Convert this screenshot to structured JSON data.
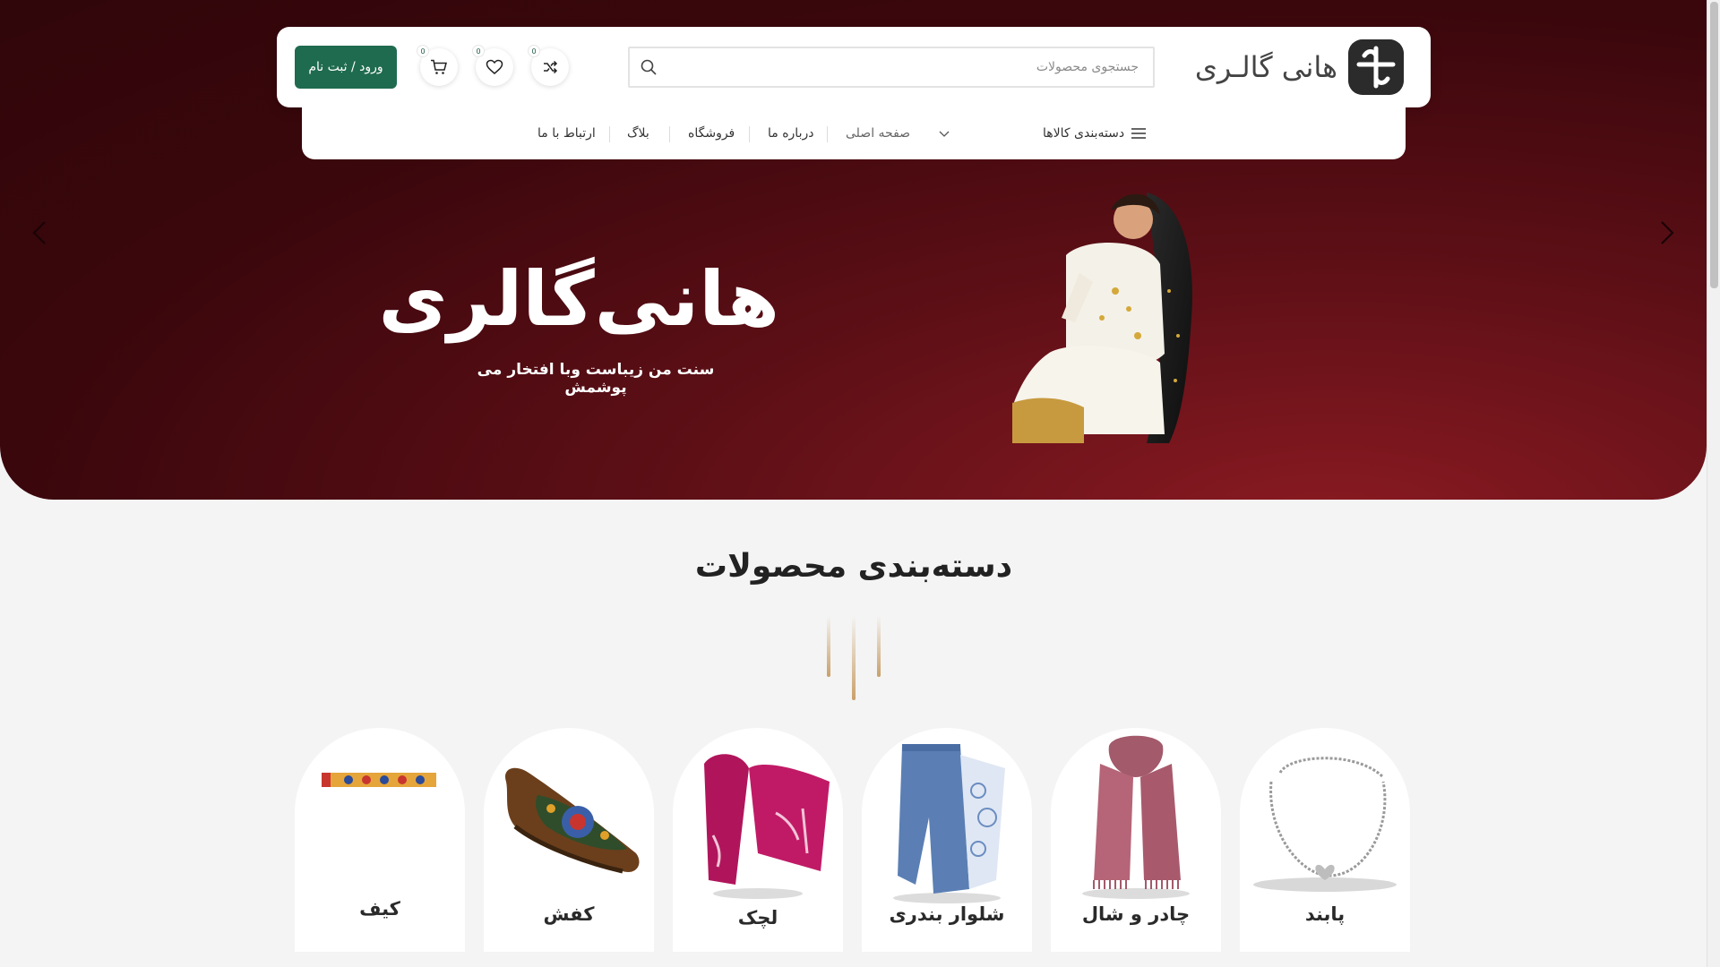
{
  "brand": {
    "name": "هانی گالـری"
  },
  "search": {
    "placeholder": "جستجوی محصولات"
  },
  "header_icons": {
    "compare_count": "0",
    "wishlist_count": "0",
    "cart_count": "0"
  },
  "auth": {
    "login_label": "ورود / ثبت نام"
  },
  "nav": {
    "categories_label": "دسته‌بندی کالاها",
    "items": [
      "صفحه اصلی",
      "درباره ما",
      "فروشگاه",
      "بلاگ",
      "ارتباط با ما"
    ]
  },
  "hero": {
    "title": "هانی‌گالری",
    "subtitle": "سنت من زیباست وبا افتخار می پوشمش"
  },
  "categories_section": {
    "title": "دسته‌بندی محصولات",
    "items": [
      {
        "label": "پابند",
        "icon": "anklet"
      },
      {
        "label": "چادر و شال",
        "icon": "scarf"
      },
      {
        "label": "شلوار بندری",
        "icon": "pants"
      },
      {
        "label": "لچک",
        "icon": "headscarf"
      },
      {
        "label": "کفش",
        "icon": "shoe"
      },
      {
        "label": "کیف",
        "icon": "bag"
      }
    ]
  },
  "colors": {
    "hero_dark": "#30060a",
    "hero_accent": "#8a1a22",
    "login_button": "#1f6b4f",
    "deco_gold": "#c9a06a"
  }
}
